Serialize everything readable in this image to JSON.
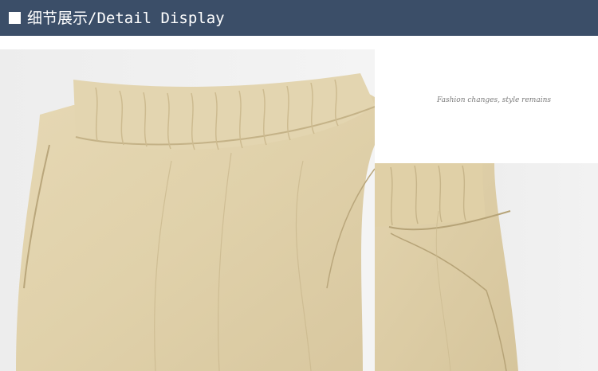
{
  "header": {
    "title": "细节展示/Detail Display",
    "bar_color": "#3b4e68"
  },
  "tagline": "Fashion changes, style remains",
  "icons": {
    "bullet": "filled-square-icon"
  },
  "colors": {
    "fabric": "#e2d3ad",
    "fabric_shadow": "#c8b78d",
    "background": "#ffffff"
  }
}
